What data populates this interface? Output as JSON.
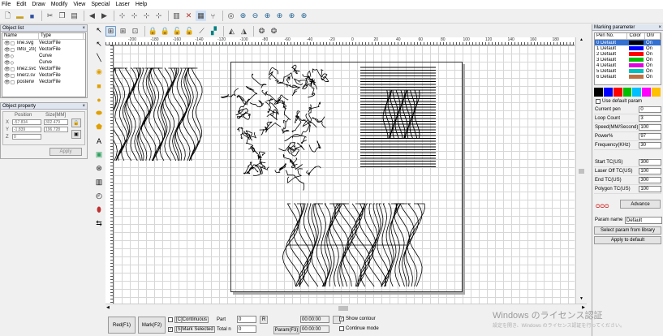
{
  "menu": [
    "File",
    "Edit",
    "Draw",
    "Modify",
    "View",
    "Special",
    "Laser",
    "Help"
  ],
  "object_list": {
    "title": "Object list",
    "headers": [
      "Name",
      "Type"
    ],
    "rows": [
      {
        "name": "line.svg",
        "type": "VectorFile"
      },
      {
        "name": "IMG_20(",
        "type": "VectorFile"
      },
      {
        "name": "",
        "type": "Curve"
      },
      {
        "name": "",
        "type": "Curve"
      },
      {
        "name": "line2.svc",
        "type": "VectorFile"
      },
      {
        "name": "liner2.sv",
        "type": "VectorFile"
      },
      {
        "name": "posterw",
        "type": "VectorFile"
      }
    ]
  },
  "object_property": {
    "title": "Object property",
    "position_label": "Position",
    "size_label": "Size[MM]",
    "x_label": "X",
    "y_label": "Y",
    "z_label": "Z",
    "x_value": "-57.834",
    "y_value": "-1.839",
    "z_value": "0",
    "w_value": "302.479",
    "h_value": "196.728",
    "apply_label": "Apply"
  },
  "ruler_labels": [
    "-200",
    "-180",
    "-160",
    "-140",
    "-120",
    "-100",
    "-80",
    "-60",
    "-40",
    "-20",
    "0",
    "20",
    "40",
    "60",
    "80",
    "100",
    "120",
    "140",
    "160",
    "180",
    "20"
  ],
  "bottom": {
    "red_label": "Red(F1)",
    "mark_label": "Mark(F2)",
    "continuous_label": "[C]Continuous",
    "mark_selected_label": "[S]Mark Selected",
    "part_label": "Part",
    "part_value": "0",
    "r_label": "R",
    "total_label": "Total n",
    "total_value": "0",
    "time1": "00:00:00",
    "time2": "00:00:00",
    "param_label": "Param(F3)",
    "show_contour_label": "Show contour",
    "continue_mode_label": "Continue mode"
  },
  "marking": {
    "title": "Marking parameter",
    "headers": [
      "Pen No.",
      "Color",
      "On/"
    ],
    "pens": [
      {
        "no": "0 Default",
        "color": "#000000",
        "on": "On"
      },
      {
        "no": "1 Default",
        "color": "#0000ff",
        "on": "On"
      },
      {
        "no": "2 Default",
        "color": "#ff0000",
        "on": "On"
      },
      {
        "no": "3 Default",
        "color": "#00c000",
        "on": "On"
      },
      {
        "no": "4 Default",
        "color": "#e000e0",
        "on": "On"
      },
      {
        "no": "5 Default",
        "color": "#00c0c0",
        "on": "On"
      },
      {
        "no": "6 Default",
        "color": "#c07040",
        "on": "On"
      }
    ],
    "swatches": [
      "#000000",
      "#0000ff",
      "#ff0000",
      "#00c000",
      "#00c0ff",
      "#ff00ff",
      "#ffc000"
    ],
    "use_default": "Use default param",
    "fields": [
      {
        "label": "Current pen",
        "value": "0"
      },
      {
        "label": "Loop Count",
        "value": "3"
      },
      {
        "label": "Speed(MM/Second)",
        "value": "100"
      },
      {
        "label": "Power%",
        "value": "97"
      },
      {
        "label": "Frequency(KHz)",
        "value": "30"
      }
    ],
    "fields2": [
      {
        "label": "Start TC(US)",
        "value": "300"
      },
      {
        "label": "Laser Off TC(US)",
        "value": "100"
      },
      {
        "label": "End TC(US)",
        "value": "300"
      },
      {
        "label": "Polygon TC(US)",
        "value": "100"
      }
    ],
    "advance_label": "Advance",
    "param_name_label": "Param name",
    "param_name_value": "Default",
    "select_param_label": "Select param from library",
    "apply_default_label": "Apply to default"
  },
  "watermark": {
    "line1": "Windows のライセンス認証",
    "line2": "設定を開き、Windows のライセンス認証を行ってください。"
  }
}
